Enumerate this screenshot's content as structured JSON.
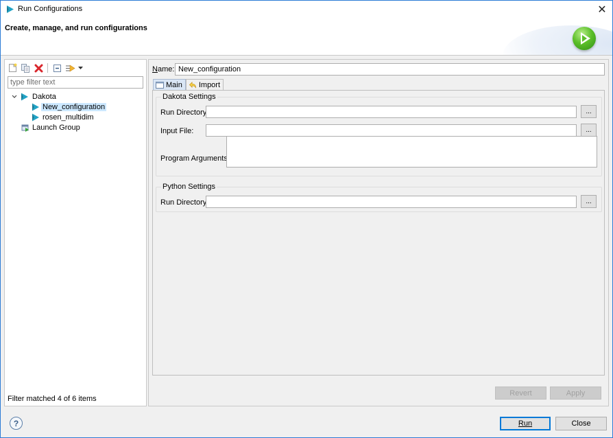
{
  "window": {
    "title": "Run Configurations",
    "close_glyph": "✕"
  },
  "banner": {
    "heading": "Create, manage, and run configurations",
    "icon": "run-icon"
  },
  "left_panel": {
    "toolbar": [
      {
        "name": "new-launch-configuration",
        "icon": "new-config-icon"
      },
      {
        "name": "duplicate",
        "icon": "duplicate-icon"
      },
      {
        "name": "delete",
        "icon": "delete-icon"
      },
      {
        "name": "collapse-all",
        "icon": "collapse-all-icon"
      },
      {
        "name": "filter-configurations",
        "icon": "filter-icon"
      },
      {
        "name": "view-menu",
        "icon": "dropdown-arrow-icon"
      }
    ],
    "filter_placeholder": "type filter text",
    "filter_value": "",
    "tree": [
      {
        "label": "Dakota",
        "level": 0,
        "expanded": true,
        "icon": "dakota-icon"
      },
      {
        "label": "New_configuration",
        "level": 1,
        "selected": true,
        "icon": "dakota-icon"
      },
      {
        "label": "rosen_multidim",
        "level": 1,
        "icon": "dakota-icon"
      },
      {
        "label": "Launch Group",
        "level": 0,
        "icon": "launch-group-icon"
      }
    ],
    "status": "Filter matched 4 of 6 items"
  },
  "right_panel": {
    "name_label": "Name:",
    "name_mnemonic": "N",
    "name_rest": "ame:",
    "name_value": "New_configuration",
    "tabs": [
      {
        "label": "Main",
        "active": true,
        "icon": "main-tab-icon"
      },
      {
        "label": "Import",
        "active": false,
        "icon": "import-icon"
      }
    ],
    "dakota_settings": {
      "title": "Dakota Settings",
      "run_directory_label": "Run Directory:",
      "run_directory_value": "",
      "input_file_label": "Input File:",
      "input_file_value": "",
      "program_arguments_label": "Program Arguments:",
      "program_arguments_value": "",
      "browse_label": "..."
    },
    "python_settings": {
      "title": "Python Settings",
      "run_directory_label": "Run Directory:",
      "run_directory_value": "",
      "browse_label": "..."
    },
    "revert_label": "Revert",
    "apply_label": "Apply"
  },
  "footer": {
    "help_glyph": "?",
    "run_label": "Run",
    "close_label": "Close"
  },
  "colors": {
    "accent": "#0078d7",
    "selection": "#cce8ff",
    "dakota_icon": "#1fa3c6",
    "delete_icon": "#d9262c",
    "run_green": "#5cbf2a"
  }
}
